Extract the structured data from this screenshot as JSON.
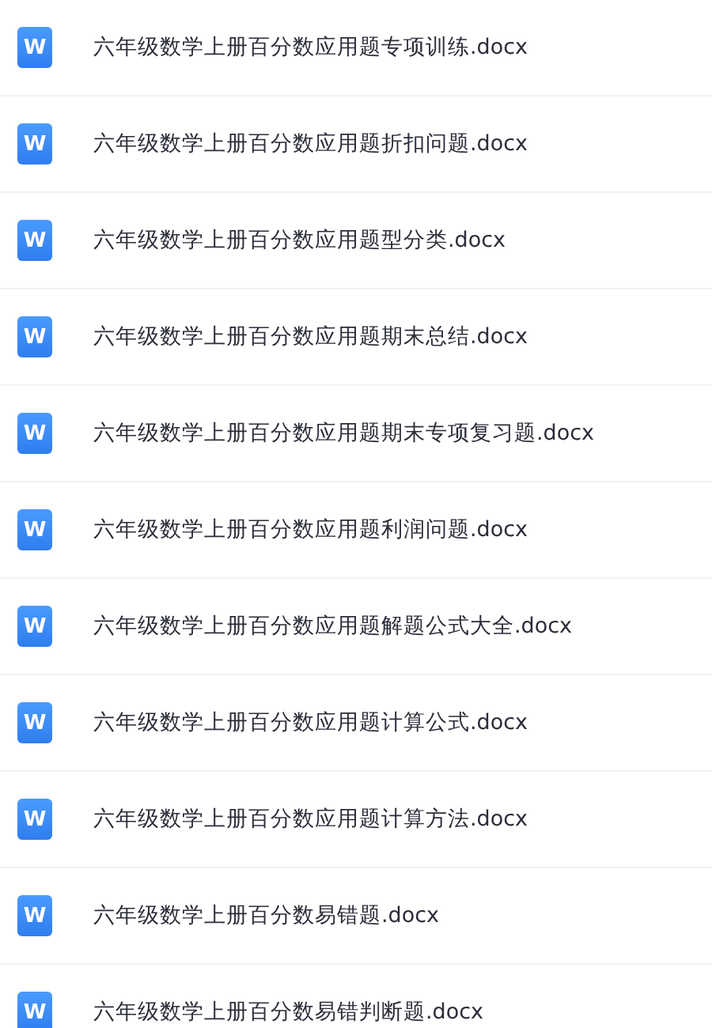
{
  "files": [
    {
      "icon_letter": "W",
      "name": "六年级数学上册百分数应用题专项训练.docx"
    },
    {
      "icon_letter": "W",
      "name": "六年级数学上册百分数应用题折扣问题.docx"
    },
    {
      "icon_letter": "W",
      "name": "六年级数学上册百分数应用题型分类.docx"
    },
    {
      "icon_letter": "W",
      "name": "六年级数学上册百分数应用题期末总结.docx"
    },
    {
      "icon_letter": "W",
      "name": "六年级数学上册百分数应用题期末专项复习题.docx"
    },
    {
      "icon_letter": "W",
      "name": "六年级数学上册百分数应用题利润问题.docx"
    },
    {
      "icon_letter": "W",
      "name": "六年级数学上册百分数应用题解题公式大全.docx"
    },
    {
      "icon_letter": "W",
      "name": "六年级数学上册百分数应用题计算公式.docx"
    },
    {
      "icon_letter": "W",
      "name": "六年级数学上册百分数应用题计算方法.docx"
    },
    {
      "icon_letter": "W",
      "name": "六年级数学上册百分数易错题.docx"
    },
    {
      "icon_letter": "W",
      "name": "六年级数学上册百分数易错判断题.docx"
    }
  ]
}
